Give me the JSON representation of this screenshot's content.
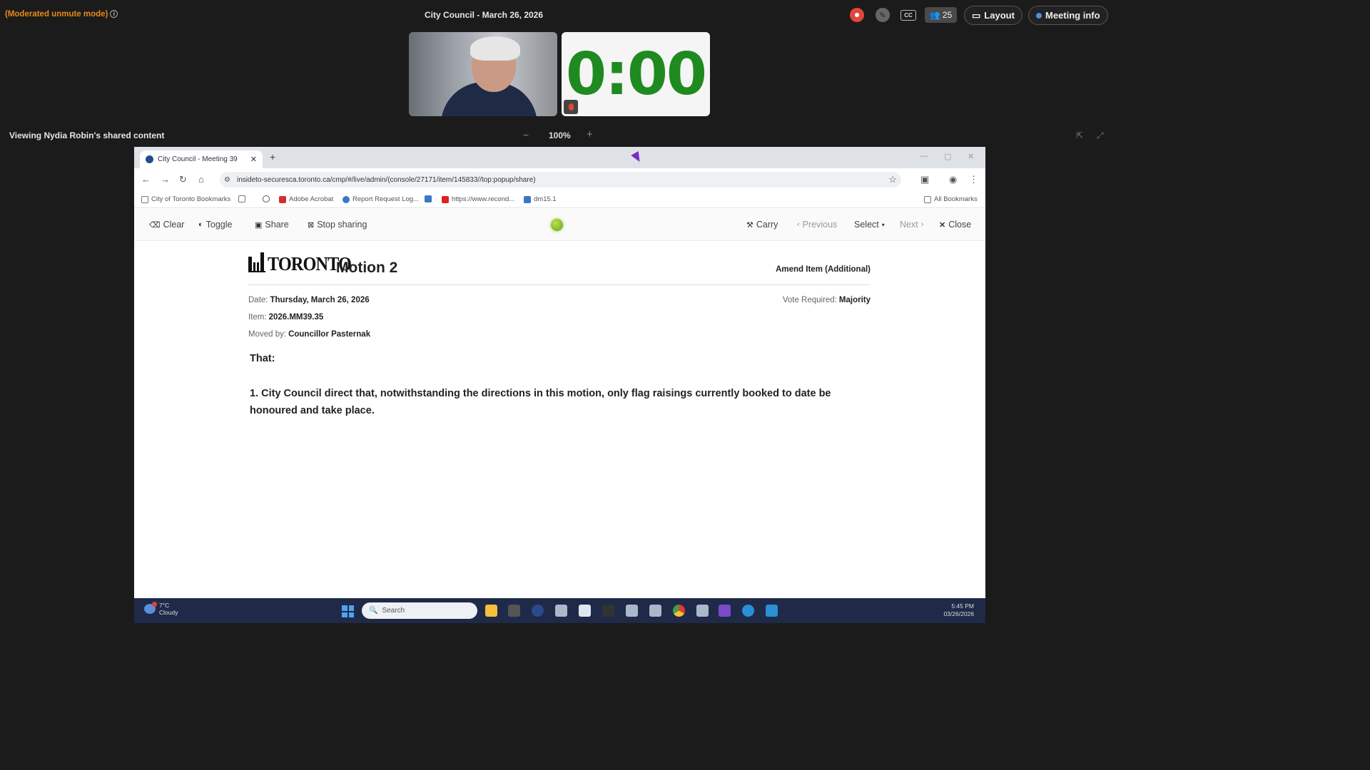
{
  "meeting": {
    "mode_label": "(Moderated unmute mode)",
    "title": "City Council - March 26, 2026",
    "participants_count": "25",
    "layout_label": "Layout",
    "meeting_info_label": "Meeting info",
    "timer_text": "0:00",
    "colors": {
      "mode": "#e8891b",
      "record": "#e0473a",
      "timer": "#1f8a1f"
    }
  },
  "share_bar": {
    "viewing_label": "Viewing Nydia Robin's shared content",
    "zoom_minus": "−",
    "zoom_value": "100%",
    "zoom_plus": "+"
  },
  "browser": {
    "tab_title": "City Council - Meeting 39",
    "url": "insideto-securesca.toronto.ca/cmp/#/live/admin/(console/27171/item/145833//top:popup/share)",
    "bookmarks": [
      {
        "label": "City of Toronto Bookmarks"
      },
      {
        "label": "Adobe Acrobat"
      },
      {
        "label": "Report Request Log..."
      },
      {
        "label": "https://www.recond..."
      },
      {
        "label": "dm15.1"
      },
      {
        "label": "All Bookmarks"
      }
    ]
  },
  "toolbar": {
    "clear": "Clear",
    "toggle": "Toggle",
    "share": "Share",
    "stop_sharing": "Stop sharing",
    "carry": "Carry",
    "previous": "Previous",
    "select": "Select",
    "next": "Next",
    "close": "Close"
  },
  "motion": {
    "logo_text": "TORONTO",
    "title": "Motion 2",
    "type": "Amend Item (Additional)",
    "date_label": "Date:",
    "date_value": "Thursday, March 26, 2026",
    "item_label": "Item:",
    "item_value": "2026.MM39.35",
    "moved_label": "Moved by:",
    "moved_value": "Councillor Pasternak",
    "vote_label": "Vote Required:",
    "vote_value": "Majority",
    "that": "That:",
    "paragraph": "1. City Council direct that, notwithstanding the directions in this motion, only flag raisings currently booked to date be honoured and take place."
  },
  "taskbar": {
    "temp": "7°C",
    "weather": "Cloudy",
    "search_placeholder": "Search",
    "time": "5:45 PM",
    "date": "03/26/2026"
  }
}
